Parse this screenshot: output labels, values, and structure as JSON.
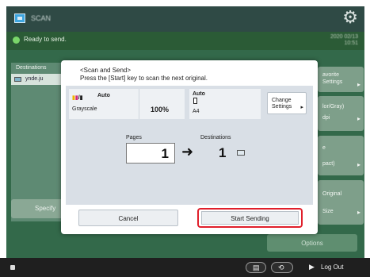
{
  "app": {
    "title": "SCAN"
  },
  "status": {
    "message": "Ready to send.",
    "time_line1": "2020 02/13",
    "time_line2": "10:51"
  },
  "destinations": {
    "header": "Destinations",
    "rows": [
      "ynde.ju"
    ]
  },
  "specify": {
    "label": "Specify"
  },
  "right_buttons": [
    {
      "line1": "avorite",
      "line2": "Settings"
    },
    {
      "line1": "lor/Gray)",
      "line2": "dpi"
    },
    {
      "line1": "e",
      "line2": "pact)"
    },
    {
      "line1": "Original",
      "line2": "Size"
    }
  ],
  "options": {
    "label": "Options"
  },
  "dialog": {
    "title": "<Scan and Send>",
    "instruction": "Press the [Start] key to scan the next original.",
    "settings": {
      "color_auto": "Auto",
      "color_mode": "Grayscale",
      "zoom": "100%",
      "size_auto": "Auto",
      "paper_size": "A4"
    },
    "change_settings": {
      "line1": "Change",
      "line2": "Settings"
    },
    "pages": {
      "caption": "Pages",
      "value": "1"
    },
    "destinations_count": {
      "caption": "Destinations",
      "value": "1"
    },
    "cancel_label": "Cancel",
    "start_label": "Start Sending"
  },
  "bottom": {
    "logout_label": "Log Out"
  },
  "colors": {
    "highlight": "#e01f2b",
    "status_green": "#2b5b36",
    "main_green": "#33694a"
  },
  "icons": [
    "app-icon",
    "gear-icon",
    "status-dot-icon",
    "color-mode-icon",
    "paper-icon",
    "arrow-right-icon",
    "destination-icon",
    "logout-icon"
  ]
}
